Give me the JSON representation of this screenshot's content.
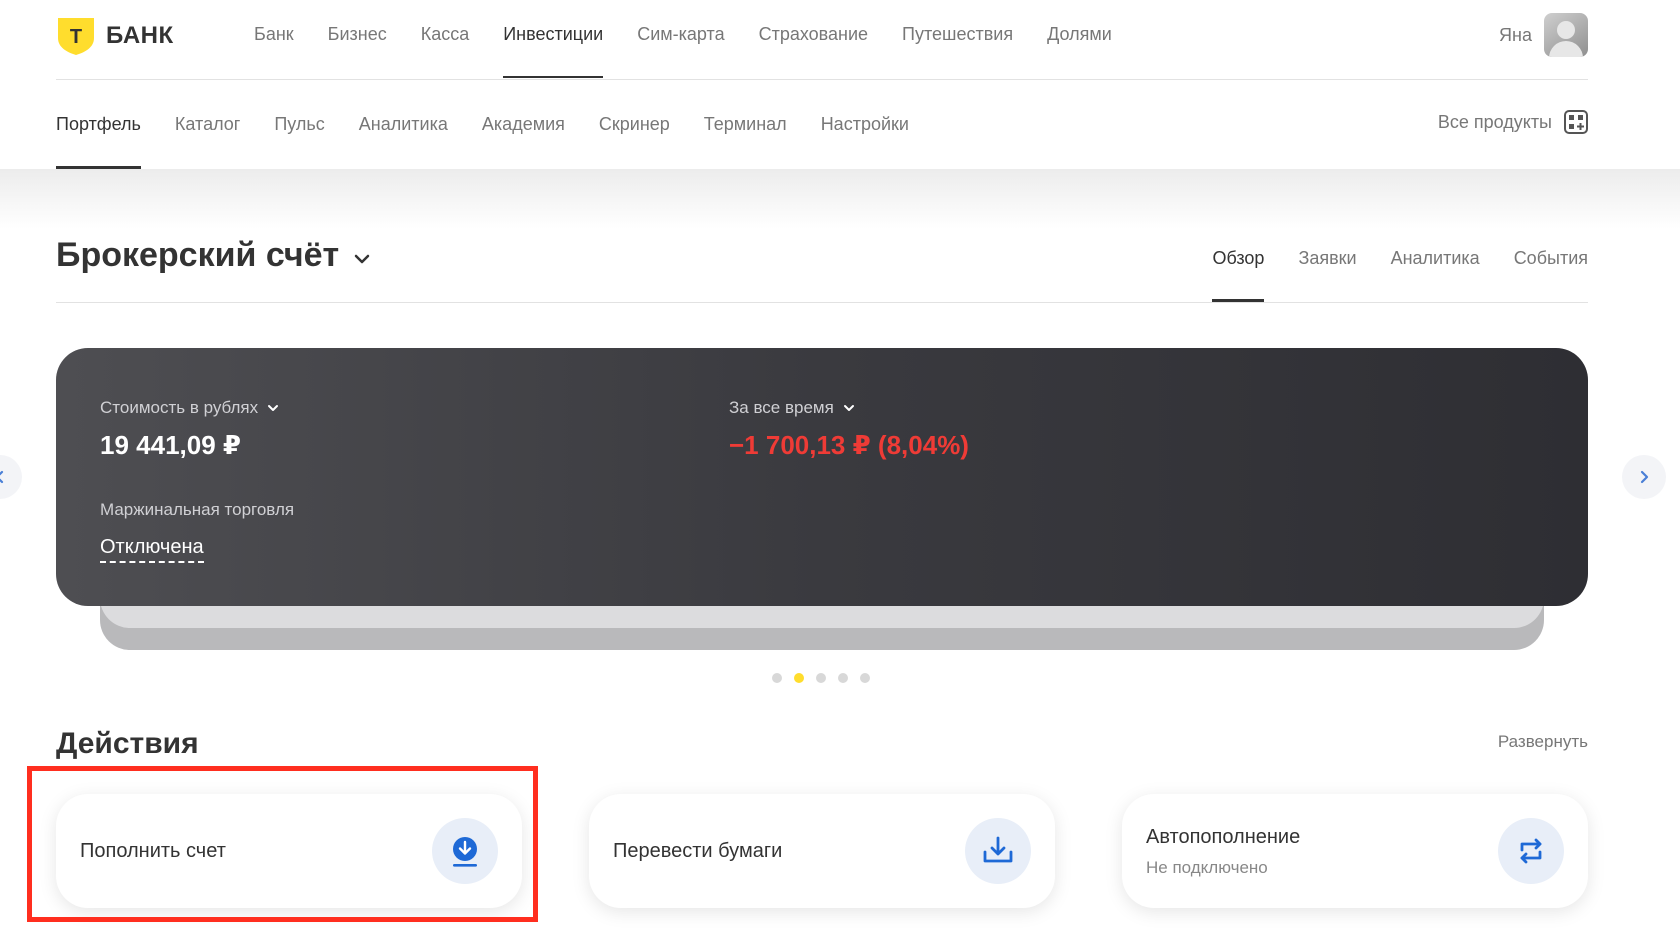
{
  "brand": {
    "logo_letter": "Т",
    "name": "БАНК",
    "accent": "#ffdd2d"
  },
  "main_nav": {
    "items": [
      {
        "label": "Банк"
      },
      {
        "label": "Бизнес"
      },
      {
        "label": "Касса"
      },
      {
        "label": "Инвестиции"
      },
      {
        "label": "Сим-карта"
      },
      {
        "label": "Страхование"
      },
      {
        "label": "Путешествия"
      },
      {
        "label": "Долями"
      }
    ],
    "active": "Инвестиции"
  },
  "user": {
    "name": "Яна"
  },
  "sub_nav": {
    "items": [
      {
        "label": "Портфель"
      },
      {
        "label": "Каталог"
      },
      {
        "label": "Пульс"
      },
      {
        "label": "Аналитика"
      },
      {
        "label": "Академия"
      },
      {
        "label": "Скринер"
      },
      {
        "label": "Терминал"
      },
      {
        "label": "Настройки"
      }
    ],
    "active": "Портфель",
    "all_products_label": "Все продукты"
  },
  "account": {
    "title": "Брокерский счёт",
    "tabs": [
      {
        "label": "Обзор"
      },
      {
        "label": "Заявки"
      },
      {
        "label": "Аналитика"
      },
      {
        "label": "События"
      }
    ],
    "active_tab": "Обзор"
  },
  "portfolio_card": {
    "value_label": "Стоимость в рублях",
    "value": "19 441,09 ₽",
    "period_label": "За все время",
    "pnl": "−1 700,13 ₽ (8,04%)",
    "pnl_color": "#ef3b36",
    "margin_label": "Маржинальная торговля",
    "margin_status": "Отключена"
  },
  "carousel": {
    "dots": 5,
    "active_index": 1
  },
  "actions": {
    "title": "Действия",
    "expand_label": "Развернуть",
    "items": [
      {
        "label": "Пополнить счет",
        "icon": "download-circle-icon"
      },
      {
        "label": "Перевести бумаги",
        "icon": "tray-download-icon"
      },
      {
        "label": "Автопополнение",
        "sub": "Не подключено",
        "icon": "repeat-arrows-icon"
      }
    ]
  },
  "highlight_color": "#ff2e1f"
}
